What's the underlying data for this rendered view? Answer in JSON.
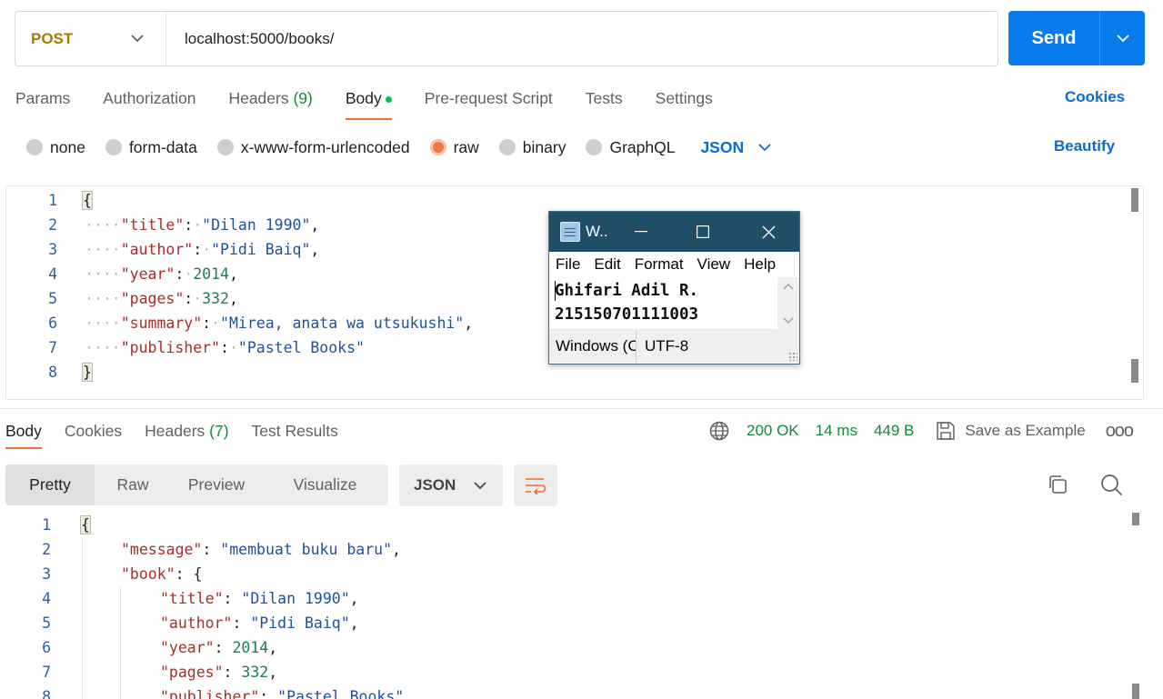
{
  "request": {
    "method": "POST",
    "url": "localhost:5000/books/",
    "send_label": "Send"
  },
  "request_tabs": [
    {
      "label": "Params"
    },
    {
      "label": "Authorization"
    },
    {
      "label": "Headers",
      "count": "(9)"
    },
    {
      "label": "Body"
    },
    {
      "label": "Pre-request Script"
    },
    {
      "label": "Tests"
    },
    {
      "label": "Settings"
    }
  ],
  "cookies_label": "Cookies",
  "body_types": [
    "none",
    "form-data",
    "x-www-form-urlencoded",
    "raw",
    "binary",
    "GraphQL"
  ],
  "body_format": "JSON",
  "beautify_label": "Beautify",
  "request_body": {
    "line_numbers": [
      "1",
      "2",
      "3",
      "4",
      "5",
      "6",
      "7",
      "8"
    ],
    "open_brace": "{",
    "close_brace": "}",
    "title_key": "\"title\"",
    "title_val": "\"Dilan 1990\"",
    "author_key": "\"author\"",
    "author_val": "\"Pidi Baiq\"",
    "year_key": "\"year\"",
    "year_val": "2014",
    "pages_key": "\"pages\"",
    "pages_val": "332",
    "summary_key": "\"summary\"",
    "summary_val": "\"Mirea, anata wa utsukushi\"",
    "publisher_key": "\"publisher\"",
    "publisher_val": "\"Pastel Books\""
  },
  "notepad": {
    "title": "W..",
    "menu": [
      "File",
      "Edit",
      "Format",
      "View",
      "Help"
    ],
    "text_line1": "Ghifari Adil R.",
    "text_line2": "215150701111003",
    "status_line_ending": "Windows (CRLF)",
    "status_encoding": "UTF-8"
  },
  "response_tabs": [
    {
      "label": "Body"
    },
    {
      "label": "Cookies"
    },
    {
      "label": "Headers",
      "count": "(7)"
    },
    {
      "label": "Test Results"
    }
  ],
  "response_stats": {
    "status": "200 OK",
    "time": "14 ms",
    "size": "449 B",
    "save_label": "Save as Example",
    "more": "ooo"
  },
  "view_modes": [
    "Pretty",
    "Raw",
    "Preview",
    "Visualize"
  ],
  "response_format": "JSON",
  "response_body": {
    "line_numbers": [
      "1",
      "2",
      "3",
      "4",
      "5",
      "6",
      "7",
      "8"
    ],
    "open_brace": "{",
    "message_key": "\"message\"",
    "message_val": "\"membuat buku baru\"",
    "book_key": "\"book\"",
    "title_key": "\"title\"",
    "title_val": "\"Dilan 1990\"",
    "author_key": "\"author\"",
    "author_val": "\"Pidi Baiq\"",
    "year_key": "\"year\"",
    "year_val": "2014",
    "pages_key": "\"pages\"",
    "pages_val": "332",
    "publisher_key": "\"publisher\"",
    "publisher_val": "\"Pastel Books\""
  },
  "colors": {
    "send": "#097bed",
    "method": "#a87b00",
    "accent": "#f26b3a",
    "link": "#0b6ad4",
    "status_green": "#0f8a3b"
  }
}
